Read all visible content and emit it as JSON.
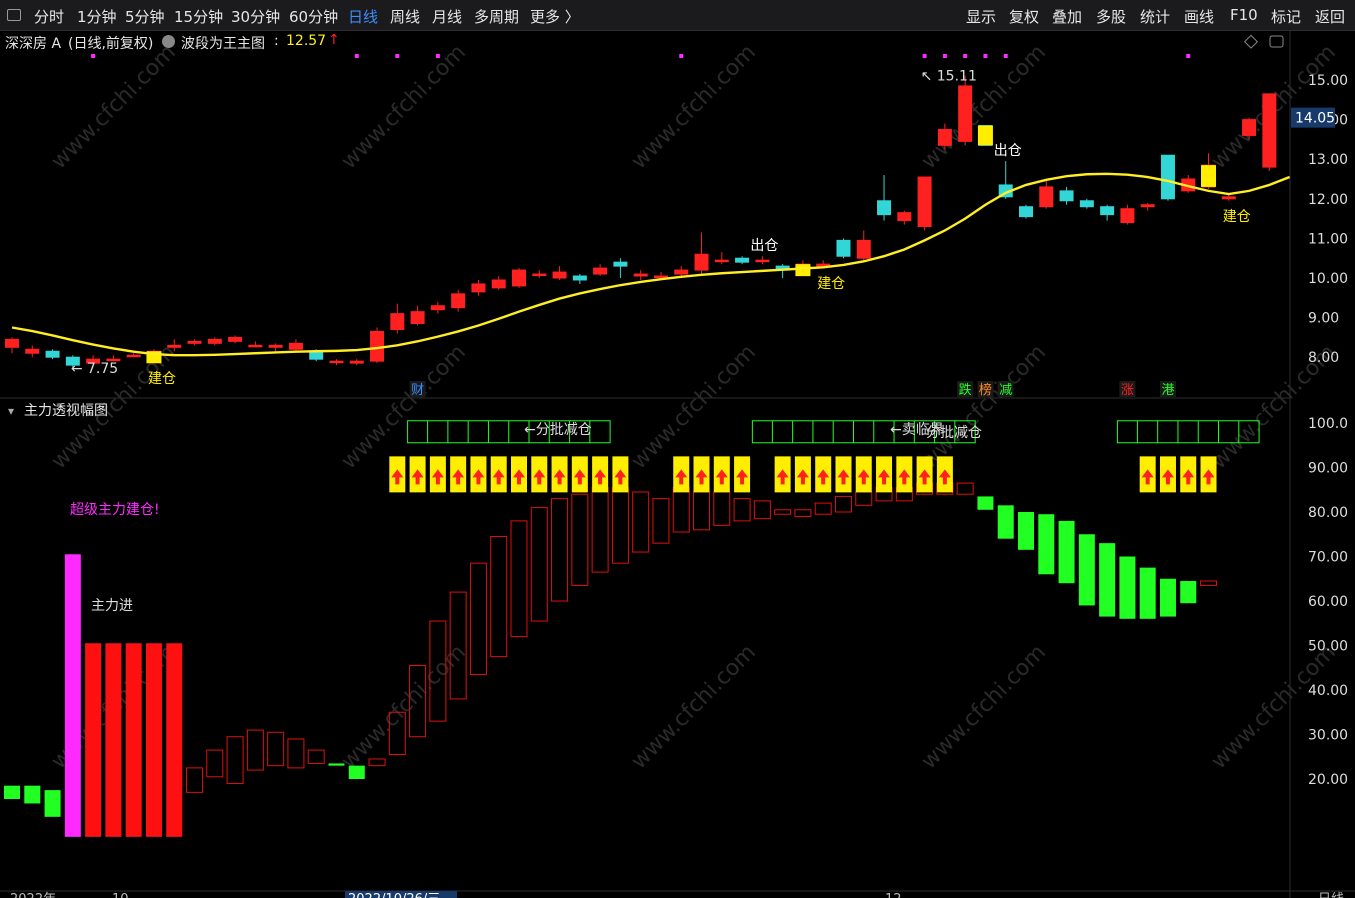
{
  "toolbar": {
    "periods": [
      "分时",
      "1分钟",
      "5分钟",
      "15分钟",
      "30分钟",
      "60分钟",
      "日线",
      "周线",
      "月线",
      "多周期",
      "更多 〉"
    ],
    "active_period": "日线",
    "right_tools": [
      "显示",
      "复权",
      "叠加",
      "多股",
      "统计",
      "画线",
      "F10",
      "标记",
      "返回"
    ]
  },
  "header": {
    "stock_name": "深深房 A",
    "mode": "(日线,前复权)",
    "indicator_name": "波段为王主图",
    "indicator_value": "12.57",
    "up_arrow": "↑"
  },
  "sub_header": {
    "title": "主力透视幅图"
  },
  "colors": {
    "background": "#000000",
    "up_candle": "#ff2020",
    "down_candle": "#33d6d6",
    "ma_line": "#ffee22",
    "accent_yellow": "#ffee00",
    "magenta": "#ff2aff",
    "green": "#22ff22",
    "red": "#ff1010",
    "active_tab": "#3d8cff"
  },
  "chart_data": [
    {
      "type": "candlestick",
      "title": "深深房 A (日线,前复权)",
      "ylim": [
        7.4,
        15.7
      ],
      "yticks": [
        "15.00",
        "14.00",
        "13.00",
        "12.00",
        "11.00",
        "10.00",
        "9.00",
        "8.00"
      ],
      "current_price_label": "14.05",
      "current_price": 14.05,
      "candles": [
        [
          8.25,
          8.45,
          8.1,
          8.5
        ],
        [
          8.1,
          8.2,
          8.0,
          8.3
        ],
        [
          8.15,
          8.0,
          7.95,
          8.2
        ],
        [
          8.0,
          7.8,
          7.75,
          8.05
        ],
        [
          7.85,
          7.95,
          7.8,
          8.05
        ],
        [
          7.95,
          7.95,
          7.9,
          8.05
        ],
        [
          8.05,
          8.05,
          8.0,
          8.1
        ],
        [
          7.9,
          8.15,
          7.85,
          8.2
        ],
        [
          8.25,
          8.3,
          8.15,
          8.45
        ],
        [
          8.35,
          8.4,
          8.3,
          8.45
        ],
        [
          8.35,
          8.45,
          8.3,
          8.5
        ],
        [
          8.4,
          8.5,
          8.35,
          8.55
        ],
        [
          8.3,
          8.3,
          8.25,
          8.4
        ],
        [
          8.25,
          8.3,
          8.15,
          8.35
        ],
        [
          8.2,
          8.35,
          8.15,
          8.45
        ],
        [
          8.15,
          7.95,
          7.9,
          8.2
        ],
        [
          7.9,
          7.9,
          7.8,
          7.95
        ],
        [
          7.85,
          7.9,
          7.8,
          7.95
        ],
        [
          7.9,
          8.65,
          7.85,
          8.75
        ],
        [
          8.7,
          9.1,
          8.6,
          9.35
        ],
        [
          8.85,
          9.15,
          8.8,
          9.3
        ],
        [
          9.2,
          9.3,
          9.1,
          9.4
        ],
        [
          9.25,
          9.6,
          9.15,
          9.7
        ],
        [
          9.65,
          9.85,
          9.55,
          9.95
        ],
        [
          9.75,
          9.95,
          9.7,
          10.05
        ],
        [
          9.8,
          10.2,
          9.75,
          10.25
        ],
        [
          10.1,
          10.1,
          10.0,
          10.2
        ],
        [
          10.0,
          10.15,
          9.95,
          10.3
        ],
        [
          10.05,
          9.95,
          9.85,
          10.1
        ],
        [
          10.1,
          10.25,
          10.05,
          10.35
        ],
        [
          10.4,
          10.3,
          10.0,
          10.5
        ],
        [
          10.05,
          10.1,
          9.95,
          10.2
        ],
        [
          10.05,
          10.05,
          9.95,
          10.15
        ],
        [
          10.1,
          10.2,
          10.0,
          10.3
        ],
        [
          10.2,
          10.6,
          10.1,
          11.15
        ],
        [
          10.45,
          10.45,
          10.35,
          10.65
        ],
        [
          10.5,
          10.4,
          10.35,
          10.55
        ],
        [
          10.45,
          10.45,
          10.35,
          10.55
        ],
        [
          10.3,
          10.2,
          10.0,
          10.35
        ],
        [
          10.35,
          10.35,
          10.3,
          10.45
        ],
        [
          10.3,
          10.35,
          10.25,
          10.45
        ],
        [
          10.95,
          10.55,
          10.5,
          11.0
        ],
        [
          10.5,
          10.95,
          10.45,
          11.2
        ],
        [
          11.95,
          11.6,
          11.45,
          12.6
        ],
        [
          11.45,
          11.65,
          11.35,
          11.7
        ],
        [
          11.3,
          12.55,
          11.2,
          12.55
        ],
        [
          13.35,
          13.75,
          13.25,
          13.9
        ],
        [
          13.45,
          14.85,
          13.35,
          15.11
        ],
        [
          13.85,
          13.35,
          13.35,
          13.85
        ],
        [
          12.35,
          12.05,
          12.0,
          12.95
        ],
        [
          11.8,
          11.55,
          11.5,
          11.85
        ],
        [
          11.8,
          12.3,
          11.75,
          12.5
        ],
        [
          12.2,
          11.95,
          11.85,
          12.3
        ],
        [
          11.95,
          11.8,
          11.75,
          12.0
        ],
        [
          11.8,
          11.6,
          11.45,
          11.85
        ],
        [
          11.4,
          11.75,
          11.35,
          11.85
        ],
        [
          11.8,
          11.85,
          11.7,
          11.9
        ],
        [
          13.1,
          12.0,
          11.95,
          13.1
        ],
        [
          12.2,
          12.5,
          12.15,
          12.6
        ],
        [
          12.3,
          12.85,
          12.25,
          13.15
        ],
        [
          12.0,
          12.05,
          11.95,
          12.1
        ],
        [
          13.6,
          14.0,
          13.5,
          14.05
        ],
        [
          12.8,
          14.65,
          12.7,
          14.65
        ]
      ],
      "ma_values": [
        8.75,
        8.66,
        8.55,
        8.43,
        8.32,
        8.22,
        8.14,
        8.08,
        8.05,
        8.05,
        8.06,
        8.08,
        8.1,
        8.12,
        8.14,
        8.15,
        8.16,
        8.18,
        8.23,
        8.3,
        8.4,
        8.52,
        8.65,
        8.8,
        8.97,
        9.15,
        9.32,
        9.48,
        9.61,
        9.72,
        9.82,
        9.9,
        9.97,
        10.03,
        10.08,
        10.12,
        10.15,
        10.18,
        10.21,
        10.24,
        10.27,
        10.33,
        10.42,
        10.55,
        10.72,
        10.95,
        11.2,
        11.5,
        11.85,
        12.15,
        12.35,
        12.48,
        12.57,
        12.62,
        12.63,
        12.61,
        12.55,
        12.45,
        12.32,
        12.2,
        12.12,
        12.2,
        12.35,
        12.55
      ],
      "annotations": [
        {
          "text": "← 7.75",
          "type": "low"
        },
        {
          "text": "↖ 15.11",
          "type": "high"
        },
        {
          "text": "建仓",
          "type": "buy",
          "index": 7
        },
        {
          "text": "出仓",
          "type": "sell",
          "index": 37
        },
        {
          "text": "建仓",
          "type": "buy",
          "index": 40
        },
        {
          "text": "出仓",
          "type": "sell",
          "index": 49
        },
        {
          "text": "建仓",
          "type": "buy",
          "index": 60
        }
      ],
      "magenta_dots": [
        4,
        17,
        19,
        21,
        33,
        45,
        46,
        47,
        48,
        49,
        58
      ],
      "event_tags": [
        {
          "text": "财",
          "index": 20,
          "color": "#3d8cff"
        },
        {
          "text": "跌",
          "index": 47,
          "color": "#22ff22"
        },
        {
          "text": "榜",
          "index": 48,
          "color": "#ff8a22"
        },
        {
          "text": "减",
          "index": 49,
          "color": "#22ff22"
        },
        {
          "text": "涨",
          "index": 55,
          "color": "#ff2020"
        },
        {
          "text": "港",
          "index": 57,
          "color": "#22ff22"
        }
      ],
      "yellow_markers": [
        7,
        39,
        48,
        59
      ],
      "ma_color": "#ffee22"
    },
    {
      "type": "bar",
      "title": "主力透视幅图",
      "ylim": [
        7,
        104
      ],
      "yticks": [
        "100.0",
        "90.00",
        "80.00",
        "70.00",
        "60.00",
        "50.00",
        "40.00",
        "30.00",
        "20.00"
      ],
      "bars": [
        [
          15.5,
          18.5,
          "green"
        ],
        [
          14.5,
          18.5,
          "green"
        ],
        [
          11.5,
          17.5,
          "green"
        ],
        [
          7,
          70.5,
          "magenta"
        ],
        [
          7,
          50.5,
          "red"
        ],
        [
          7,
          50.5,
          "red"
        ],
        [
          7,
          50.5,
          "red"
        ],
        [
          7,
          50.5,
          "red"
        ],
        [
          7,
          50.5,
          "red"
        ],
        [
          17,
          22.5,
          "hollow"
        ],
        [
          20.5,
          26.5,
          "hollow"
        ],
        [
          19,
          29.5,
          "hollow"
        ],
        [
          22,
          31,
          "hollow"
        ],
        [
          23,
          30.5,
          "hollow"
        ],
        [
          22.5,
          29,
          "hollow"
        ],
        [
          23.5,
          26.5,
          "hollow"
        ],
        [
          23,
          23.5,
          "green"
        ],
        [
          20,
          23,
          "green"
        ],
        [
          23,
          24.5,
          "hollow"
        ],
        [
          25.5,
          35,
          "hollow"
        ],
        [
          29.5,
          45.5,
          "hollow"
        ],
        [
          33,
          55.5,
          "hollow"
        ],
        [
          38,
          62,
          "hollow"
        ],
        [
          43.5,
          68.5,
          "hollow"
        ],
        [
          47.5,
          74.5,
          "hollow"
        ],
        [
          52,
          78,
          "hollow"
        ],
        [
          55.5,
          81,
          "hollow"
        ],
        [
          60,
          83,
          "hollow"
        ],
        [
          63.5,
          84,
          "hollow"
        ],
        [
          66.5,
          85.5,
          "hollow"
        ],
        [
          68.5,
          85.5,
          "hollow"
        ],
        [
          71,
          84.5,
          "hollow"
        ],
        [
          73,
          83,
          "hollow"
        ],
        [
          75.5,
          85.5,
          "hollow"
        ],
        [
          76,
          84.5,
          "hollow"
        ],
        [
          77,
          84.5,
          "hollow"
        ],
        [
          78,
          83,
          "hollow"
        ],
        [
          78.5,
          82.5,
          "hollow"
        ],
        [
          79.5,
          80.5,
          "hollow"
        ],
        [
          79,
          80.5,
          "hollow"
        ],
        [
          79.5,
          82,
          "hollow"
        ],
        [
          80,
          83.5,
          "hollow"
        ],
        [
          81.5,
          84.5,
          "hollow"
        ],
        [
          82.5,
          85.5,
          "hollow"
        ],
        [
          82.5,
          85.5,
          "hollow"
        ],
        [
          84,
          86.5,
          "hollow"
        ],
        [
          84,
          86.5,
          "hollow"
        ],
        [
          84,
          86.5,
          "hollow"
        ],
        [
          80.5,
          83.5,
          "green"
        ],
        [
          74,
          81.5,
          "green"
        ],
        [
          71.5,
          80,
          "green"
        ],
        [
          66,
          79.5,
          "green"
        ],
        [
          64,
          78,
          "green"
        ],
        [
          59,
          75,
          "green"
        ],
        [
          56.5,
          73,
          "green"
        ],
        [
          56,
          70,
          "green"
        ],
        [
          56,
          67.5,
          "green"
        ],
        [
          56.5,
          65,
          "green"
        ],
        [
          59.5,
          64.5,
          "green"
        ],
        [
          63.5,
          64.5,
          "hollow"
        ]
      ],
      "arrow_blocks": [
        19,
        20,
        21,
        22,
        23,
        24,
        25,
        26,
        27,
        28,
        29,
        30,
        33,
        34,
        35,
        36,
        38,
        39,
        40,
        41,
        42,
        43,
        44,
        45,
        46,
        56,
        57,
        58,
        59
      ],
      "green_boxes": [
        {
          "from": 20,
          "to": 29
        },
        {
          "from": 37,
          "to": 47
        },
        {
          "from": 55,
          "to": 61
        }
      ],
      "texts": [
        {
          "text": "超级主力建仓!",
          "color": "#ff2aff"
        },
        {
          "text": "主力进",
          "color": "#dddddd"
        },
        {
          "text": "←分批减仓",
          "color": "#dddddd"
        },
        {
          "text": "←卖临界",
          "color": "#dddddd"
        },
        {
          "text": "分批减仓",
          "color": "#dddddd"
        }
      ]
    }
  ],
  "bottom_axis": {
    "labels": [
      "2022年",
      "10",
      "2022/10/26/三",
      "12",
      "日线"
    ]
  },
  "watermark": "www.cfchi.com"
}
